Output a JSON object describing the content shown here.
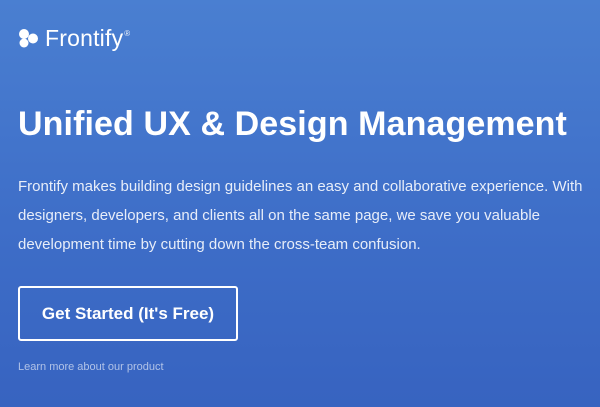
{
  "brand": {
    "name": "Frontify",
    "registered_mark": "®",
    "logo_icon": "frontify-logo-icon"
  },
  "hero": {
    "title": "Unified UX & Design Management",
    "description_lines": [
      "Frontify makes building design guidelines an easy and collaborative experience. With",
      "designers, developers, and clients all on the same page, we save you valuable",
      "development time by cutting down the cross-team confusion."
    ],
    "cta_label": "Get Started (It's Free)",
    "secondary_link": "Learn more about our product"
  },
  "colors": {
    "background_top": "#4a7fd1",
    "background_bottom": "#3763c0",
    "text": "#ffffff"
  }
}
